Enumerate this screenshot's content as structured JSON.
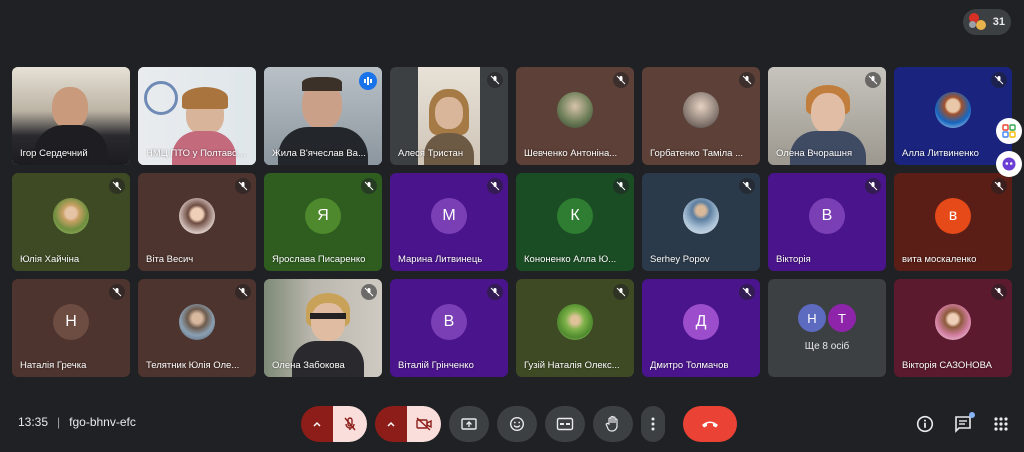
{
  "participants_count": "31",
  "meeting": {
    "time": "13:35",
    "separator": "|",
    "code": "fgo-bhnv-efc"
  },
  "tiles": [
    {
      "name": "Ігор Сердечний"
    },
    {
      "name": "НМЦ ПТО у Полтавській"
    },
    {
      "name": "Жила В'ячеслав Ва..."
    },
    {
      "name": "Алеся Тристан"
    },
    {
      "name": "Шевченко Антоніна..."
    },
    {
      "name": "Горбатенко Таміла ..."
    },
    {
      "name": "Олена Вчорашня"
    },
    {
      "name": "Алла Литвиненко"
    },
    {
      "name": "Юлія Хайчіна"
    },
    {
      "name": "Віта Весич"
    },
    {
      "name": "Ярослава Писаренко",
      "initial": "Я",
      "color": "#33691e"
    },
    {
      "name": "Марина Литвинець",
      "initial": "М",
      "color": "#7b1fa2"
    },
    {
      "name": "Кононенко Алла Ю...",
      "initial": "К",
      "color": "#2e7d32"
    },
    {
      "name": "Serhey Popov"
    },
    {
      "name": "Вікторія",
      "initial": "В",
      "color": "#7b1fa2"
    },
    {
      "name": "вита москаленко",
      "initial": "в",
      "color": "#e64a19"
    },
    {
      "name": "Наталія Гречка",
      "initial": "Н",
      "color": "#5d4037"
    },
    {
      "name": "Телятник Юлія Оле..."
    },
    {
      "name": "Олена Забокова"
    },
    {
      "name": "Віталій Грінченко",
      "initial": "В",
      "color": "#7b1fa2"
    },
    {
      "name": "Гузій Наталія Олекс..."
    },
    {
      "name": "Дмитро Толмачов",
      "initial": "Д",
      "color": "#8e24aa"
    },
    {
      "name": "Вікторія САЗОНОВА"
    }
  ],
  "more": {
    "label": "Ще 8 осіб",
    "avatars": [
      "Н",
      "Т"
    ]
  },
  "colors": {
    "background": "#202124",
    "end_call": "#ea4335",
    "muted_bg": "#8c1d18",
    "accent": "#8ab4f8"
  }
}
